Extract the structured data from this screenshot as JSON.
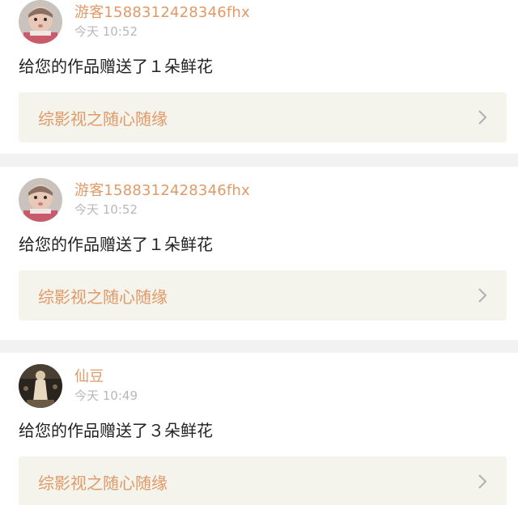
{
  "notifications": [
    {
      "user": "游客1588312428346fhx",
      "time": "今天 10:52",
      "message": "给您的作品赠送了１朵鲜花",
      "work_title": "综影视之随心随缘",
      "avatar_icon": "baby-photo-avatar"
    },
    {
      "user": "游客1588312428346fhx",
      "time": "今天 10:52",
      "message": "给您的作品赠送了１朵鲜花",
      "work_title": "综影视之随心随缘",
      "avatar_icon": "baby-photo-avatar"
    },
    {
      "user": "仙豆",
      "time": "今天 10:49",
      "message": "给您的作品赠送了３朵鲜花",
      "work_title": "综影视之随心随缘",
      "avatar_icon": "figure-photo-avatar"
    }
  ],
  "colors": {
    "accent": "#e09a67",
    "time_gray": "#b8b8b8",
    "card_link_bg": "#f4f3ec",
    "page_bg": "#f2f2f2"
  }
}
